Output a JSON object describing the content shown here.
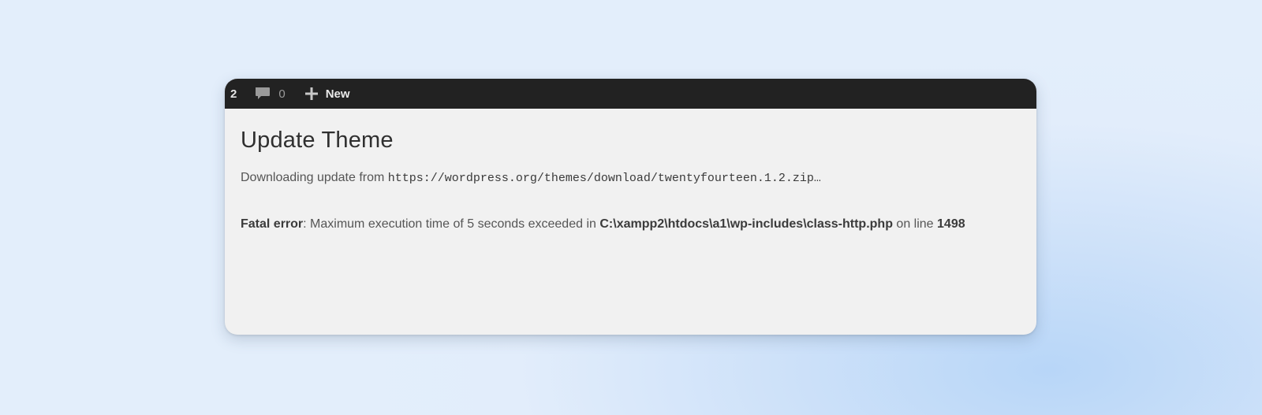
{
  "admin_bar": {
    "updates_count": "2",
    "comments_icon": "speech-bubble-icon",
    "comments_count": "0",
    "new_icon": "plus-icon",
    "new_label": "New"
  },
  "page": {
    "title": "Update Theme",
    "download_prefix": "Downloading update from",
    "download_url": "https://wordpress.org/themes/download/twentyfourteen.1.2.zip",
    "download_suffix": "…"
  },
  "error": {
    "label": "Fatal error",
    "colon": ":",
    "message": "Maximum execution time of 5 seconds exceeded in",
    "file": "C:\\xampp2\\htdocs\\a1\\wp-includes\\class-http.php",
    "line_prefix": "on line",
    "line_number": "1498"
  },
  "colors": {
    "admin_bar_bg": "#222222",
    "content_bg": "#f1f1f1",
    "page_bg": "#e3eefb"
  }
}
